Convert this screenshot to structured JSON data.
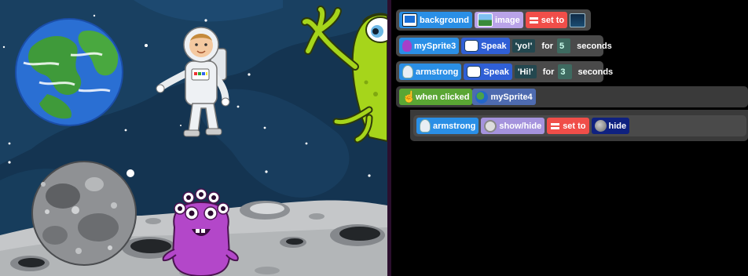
{
  "code_rows": [
    {
      "sprite_label": "background",
      "property_label": "image",
      "operator_label": "set to",
      "value_icon": "space-thumbnail-icon"
    },
    {
      "sprite_label": "mySprite3",
      "action_label": "Speak",
      "speech_text": "'yo!'",
      "for_label": "for",
      "duration": "5",
      "unit_label": "seconds"
    },
    {
      "sprite_label": "armstrong",
      "action_label": "Speak",
      "speech_text": "'Hi!'",
      "for_label": "for",
      "duration": "3",
      "unit_label": "seconds"
    },
    {
      "event_label": "when clicked",
      "target_label": "mySprite4"
    },
    {
      "sprite_label": "armstrong",
      "property_label": "show/hide",
      "operator_label": "set to",
      "value_label": "hide"
    }
  ],
  "colors": {
    "stage_background": "#143451",
    "sprite_block": "#2a8fe6",
    "property_block": "#b9a3e8",
    "operator_block": "#f04e49",
    "speak_block": "#2f5fd6",
    "event_block": "#5aa634",
    "value_block": "#0f2180"
  }
}
